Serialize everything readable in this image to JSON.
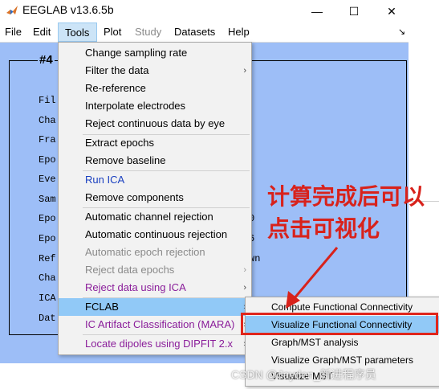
{
  "window": {
    "title": "EEGLAB v13.6.5b",
    "minimize_glyph": "—",
    "maximize_glyph": "☐",
    "close_glyph": "✕",
    "icon": "matlab-icon"
  },
  "menubar": {
    "items": [
      {
        "label": "File",
        "state": "normal"
      },
      {
        "label": "Edit",
        "state": "normal"
      },
      {
        "label": "Tools",
        "state": "active"
      },
      {
        "label": "Plot",
        "state": "normal"
      },
      {
        "label": "Study",
        "state": "disabled"
      },
      {
        "label": "Datasets",
        "state": "normal"
      },
      {
        "label": "Help",
        "state": "normal"
      }
    ],
    "right_glyph": "↘"
  },
  "dataset_panel": {
    "title": "#4",
    "labels": [
      "Fil",
      "Cha",
      "Fra",
      "Epo",
      "Eve",
      "Sam",
      "Epo",
      "Epo",
      "Ref",
      "Cha",
      "ICA",
      "Dat"
    ],
    "values": {
      "epoch_start": "0",
      "epoch_end": "6",
      "reference": "wn"
    }
  },
  "tools_menu": {
    "items": [
      {
        "label": "Change sampling rate",
        "color": "normal",
        "arrow": false
      },
      {
        "label": "Filter the data",
        "color": "normal",
        "arrow": true
      },
      {
        "label": "Re-reference",
        "color": "normal",
        "arrow": false
      },
      {
        "label": "Interpolate electrodes",
        "color": "normal",
        "arrow": false
      },
      {
        "label": "Reject continuous data by eye",
        "color": "normal",
        "arrow": false
      },
      {
        "label": "Extract epochs",
        "color": "normal",
        "arrow": false
      },
      {
        "label": "Remove baseline",
        "color": "normal",
        "arrow": false
      },
      {
        "label": "Run ICA",
        "color": "blue",
        "arrow": false
      },
      {
        "label": "Remove components",
        "color": "normal",
        "arrow": false
      },
      {
        "label": "Automatic channel rejection",
        "color": "normal",
        "arrow": false
      },
      {
        "label": "Automatic continuous rejection",
        "color": "normal",
        "arrow": false
      },
      {
        "label": "Automatic epoch rejection",
        "color": "disabled",
        "arrow": false
      },
      {
        "label": "Reject data epochs",
        "color": "disabled",
        "arrow": true
      },
      {
        "label": "Reject data using ICA",
        "color": "purple",
        "arrow": true
      },
      {
        "label": "FCLAB",
        "color": "normal",
        "arrow": true,
        "highlight": true
      },
      {
        "label": "IC Artifact Classification (MARA)",
        "color": "purple",
        "arrow": true
      },
      {
        "label": "Locate dipoles using DIPFIT 2.x",
        "color": "purple",
        "arrow": true
      }
    ],
    "arrow_glyph": "›"
  },
  "fclab_submenu": {
    "items": [
      {
        "label": "Compute Functional Connectivity",
        "highlight": false
      },
      {
        "label": "Visualize Functional Connectivity",
        "highlight": true
      },
      {
        "label": "Graph/MST analysis",
        "highlight": false
      },
      {
        "label": "Visualize Graph/MST parameters",
        "highlight": false
      },
      {
        "label": "Visualize MST",
        "highlight": false
      }
    ]
  },
  "annotation": {
    "text": "计算完成后可以点击可视化",
    "color": "#d8221b"
  },
  "watermark": "CSDN @Jayden_新进程序员",
  "colors": {
    "panel_bg": "#9dbef7",
    "menu_bg": "#f2f2f2",
    "highlight": "#91c9f7",
    "accent_red": "#e0261c"
  }
}
